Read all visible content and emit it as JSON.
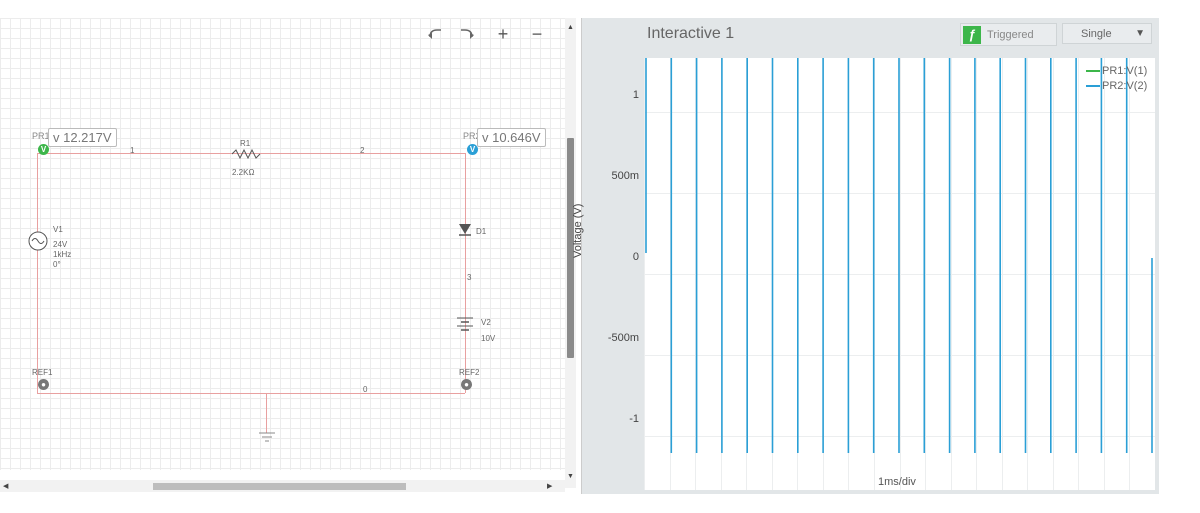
{
  "toolbar": {
    "undo_icon": "undo-icon",
    "redo_icon": "redo-icon",
    "zoom_in_label": "+",
    "zoom_out_label": "−"
  },
  "schematic": {
    "probes": [
      {
        "name": "PR1",
        "value": "v 12.217V",
        "badge": "V",
        "color": "#3cb64a"
      },
      {
        "name": "PR2",
        "value": "v 10.646V",
        "badge": "V",
        "color": "#2a9fd6"
      }
    ],
    "resistor": {
      "ref": "R1",
      "value": "2.2KΩ"
    },
    "source": {
      "ref": "V1",
      "lines": [
        "24V",
        "1kHz",
        "0°"
      ]
    },
    "diode": {
      "ref": "D1"
    },
    "battery": {
      "ref": "V2",
      "value": "10V"
    },
    "refs": [
      "REF1",
      "REF2"
    ],
    "nodes": [
      "1",
      "2",
      "3",
      "0"
    ],
    "wire_color": "#e8a0a0"
  },
  "scope": {
    "title": "Interactive 1",
    "trigger_label": "Triggered",
    "mode_value": "Single",
    "legend": [
      {
        "name": "PR1:V(1)",
        "color": "#3cb64a"
      },
      {
        "name": "PR2:V(2)",
        "color": "#2a9fd6"
      }
    ],
    "y_ticks": [
      "1",
      "500m",
      "0",
      "-500m",
      "-1"
    ],
    "y_axis_label": "Voltage (V)",
    "x_axis_label": "1ms/div"
  }
}
